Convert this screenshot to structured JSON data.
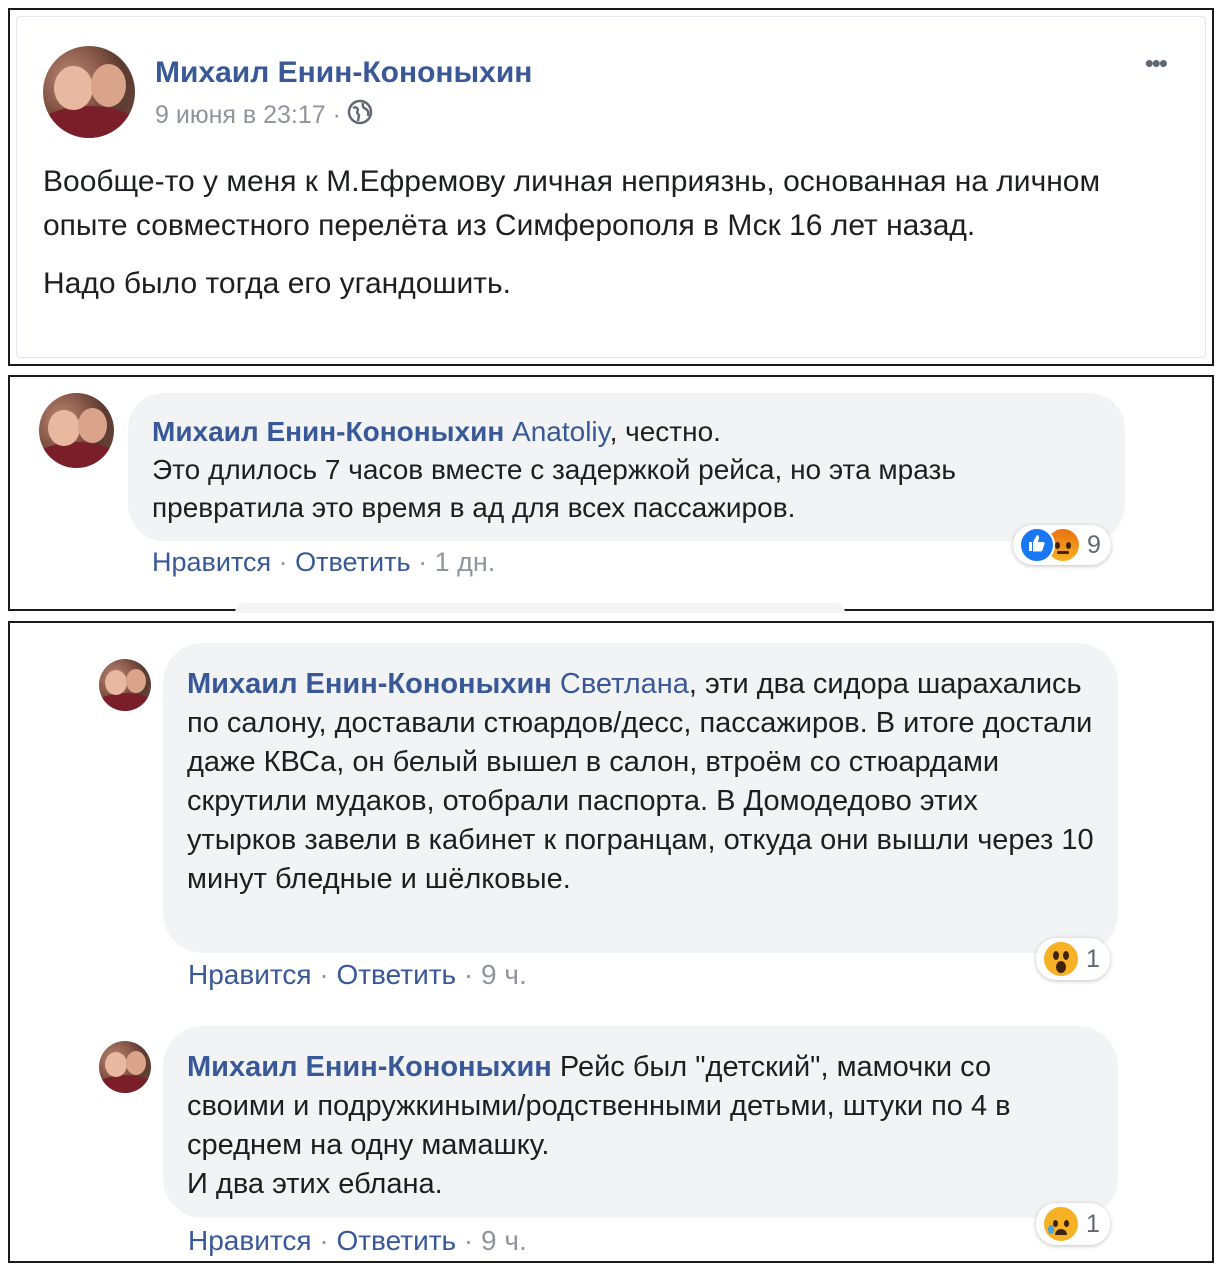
{
  "post": {
    "author": "Михаил Енин-Кононыхин",
    "timestamp": "9 июня в 23:17 ·",
    "more_label": "•••",
    "paragraphs": [
      "Вообще-то у меня к М.Ефремову личная неприязнь, основанная на личном опыте совместного перелёта из Симферополя в Мск 16 лет назад.",
      "Надо было тогда его угандошить."
    ]
  },
  "comments": [
    {
      "author": "Михаил Енин-Кононыхин",
      "mention": "Anatoliy",
      "text_first": ", честно.",
      "text_rest": "Это длилось 7 часов вместе с задержкой рейса, но эта мразь превратила это время в ад для всех пассажиров.",
      "like_label": "Нравится",
      "reply_label": "Ответить",
      "time": "1 дн.",
      "reactions": [
        "like",
        "angry"
      ],
      "reaction_count": "9"
    },
    {
      "author": "Михаил Енин-Кононыхин",
      "mention": "Светлана",
      "text_first": ", эти два сидора шарахались по салону, доставали стюардов/десс, пассажиров. В итоге достали даже КВСа, он белый вышел в салон, втроём со стюардами скрутили мудаков, отобрали паспорта. В Домодедово этих утырков завели в кабинет к погранцам, откуда они вышли через 10 минут бледные и шёлковые.",
      "like_label": "Нравится",
      "reply_label": "Ответить",
      "time": "9 ч.",
      "reactions": [
        "wow"
      ],
      "reaction_count": "1"
    },
    {
      "author": "Михаил Енин-Кононыхин",
      "text_first": " Рейс был \"детский\", мамочки со своими и подружкиными/родственными детьми, штуки по 4 в среднем на одну мамашку.",
      "text_second": "И два этих еблана.",
      "like_label": "Нравится",
      "reply_label": "Ответить",
      "time": "9 ч.",
      "reactions": [
        "sad"
      ],
      "reaction_count": "1"
    }
  ],
  "separator": " · "
}
